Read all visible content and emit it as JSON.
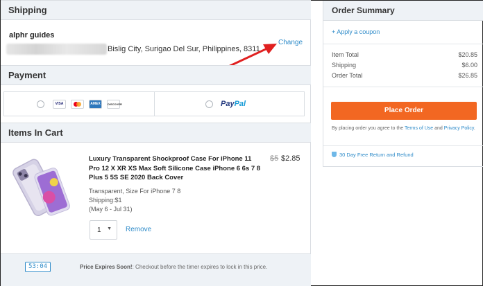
{
  "shipping": {
    "title": "Shipping",
    "name": "alphr guides",
    "address": "Bislig City, Surigao Del Sur, Philippines, 8311",
    "change_label": "Change"
  },
  "payment": {
    "title": "Payment",
    "cards": [
      "VISA",
      "MC",
      "AMEX",
      "DISCOVER"
    ],
    "paypal_a": "Pay",
    "paypal_b": "Pal"
  },
  "cart": {
    "title": "Items In Cart",
    "item": {
      "title": "Luxury Transparent Shockproof Case For iPhone 11 Pro 12 X XR XS Max Soft Silicone Case iPhone 6 6s 7 8 Plus 5 5S SE 2020 Back Cover",
      "old_price": "$5",
      "price": "$2.85",
      "variant": "Transparent, Size For iPhone 7 8",
      "shipping": "Shipping:$1",
      "delivery": "(May 6 - Jul 31)",
      "quantity": "1",
      "remove_label": "Remove"
    },
    "timer": "53:04",
    "expire_bold": "Price Expires Soon!",
    "expire_text": ": Checkout before the timer expires to lock in this price."
  },
  "summary": {
    "title": "Order Summary",
    "coupon_label": "+ Apply a coupon",
    "rows": [
      {
        "label": "Item Total",
        "value": "$20.85"
      },
      {
        "label": "Shipping",
        "value": "$6.00"
      },
      {
        "label": "Order Total",
        "value": "$26.85"
      }
    ],
    "place_order": "Place Order",
    "terms_prefix": "By placing order you agree to the ",
    "terms_link": "Terms of Use",
    "terms_and": " and ",
    "privacy_link": "Privacy Policy",
    "terms_suffix": ".",
    "refund": "30 Day Free Return and Refund"
  },
  "colors": {
    "accent": "#2e8bc9",
    "place_order": "#f26722",
    "arrow": "#e02020",
    "section_bg": "#eef2f6"
  },
  "icons": {
    "arrow": "red-arrow-annotation",
    "quantity_caret": "chevron-down-icon",
    "shield": "shield-icon"
  }
}
